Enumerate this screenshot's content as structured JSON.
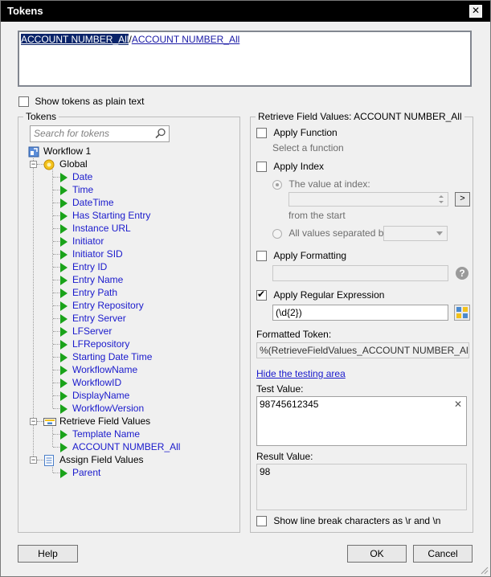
{
  "window": {
    "title": "Tokens",
    "close_glyph": "✕"
  },
  "token_editor": {
    "selected_token": "ACCOUNT NUMBER_All",
    "separator": "/",
    "second_token": "ACCOUNT NUMBER_All"
  },
  "plain_text_option": {
    "label": "Show tokens as plain text",
    "checked": false
  },
  "tokens_panel": {
    "legend": "Tokens",
    "search_placeholder": "Search for tokens",
    "workflow": "Workflow 1",
    "global": {
      "label": "Global",
      "items": [
        "Date",
        "Time",
        "DateTime",
        "Has Starting Entry",
        "Instance URL",
        "Initiator",
        "Initiator SID",
        "Entry ID",
        "Entry Name",
        "Entry Path",
        "Entry Repository",
        "Entry Server",
        "LFServer",
        "LFRepository",
        "Starting Date Time",
        "WorkflowName",
        "WorkflowID",
        "DisplayName",
        "WorkflowVersion"
      ]
    },
    "retrieve": {
      "label": "Retrieve Field Values",
      "items": [
        "Template Name",
        "ACCOUNT NUMBER_All"
      ]
    },
    "assign": {
      "label": "Assign Field Values",
      "items": [
        "Parent"
      ]
    },
    "expander_minus": "−"
  },
  "properties": {
    "legend": "Retrieve Field Values: ACCOUNT NUMBER_All",
    "apply_function": {
      "label": "Apply Function",
      "checked": false,
      "hint": "Select a function"
    },
    "apply_index": {
      "label": "Apply Index",
      "checked": false,
      "value_at_index_label": "The value at index:",
      "from_the_start": "from the  start",
      "all_values_label": "All values separated by:",
      "more_button": ">"
    },
    "apply_formatting": {
      "label": "Apply Formatting",
      "checked": false,
      "help": "?"
    },
    "apply_regex": {
      "label": "Apply Regular Expression",
      "checked": true,
      "value": "(\\d{2})"
    },
    "formatted_token": {
      "label": "Formatted Token:",
      "value": "%(RetrieveFieldValues_ACCOUNT NUMBER_All#<(\\d{"
    },
    "hide_testing_link": "Hide the testing area",
    "test_value": {
      "label": "Test Value:",
      "value": "98745612345",
      "clear": "✕"
    },
    "result_value": {
      "label": "Result Value:",
      "value": "98"
    },
    "line_breaks": {
      "label": "Show line break characters as \\r and \\n",
      "checked": false
    }
  },
  "footer": {
    "help": "Help",
    "ok": "OK",
    "cancel": "Cancel"
  },
  "colors": {
    "title_bar": "#000000",
    "link": "#1a1acc",
    "token_triangle": "#1aa31a",
    "selection": "#0a246a"
  }
}
